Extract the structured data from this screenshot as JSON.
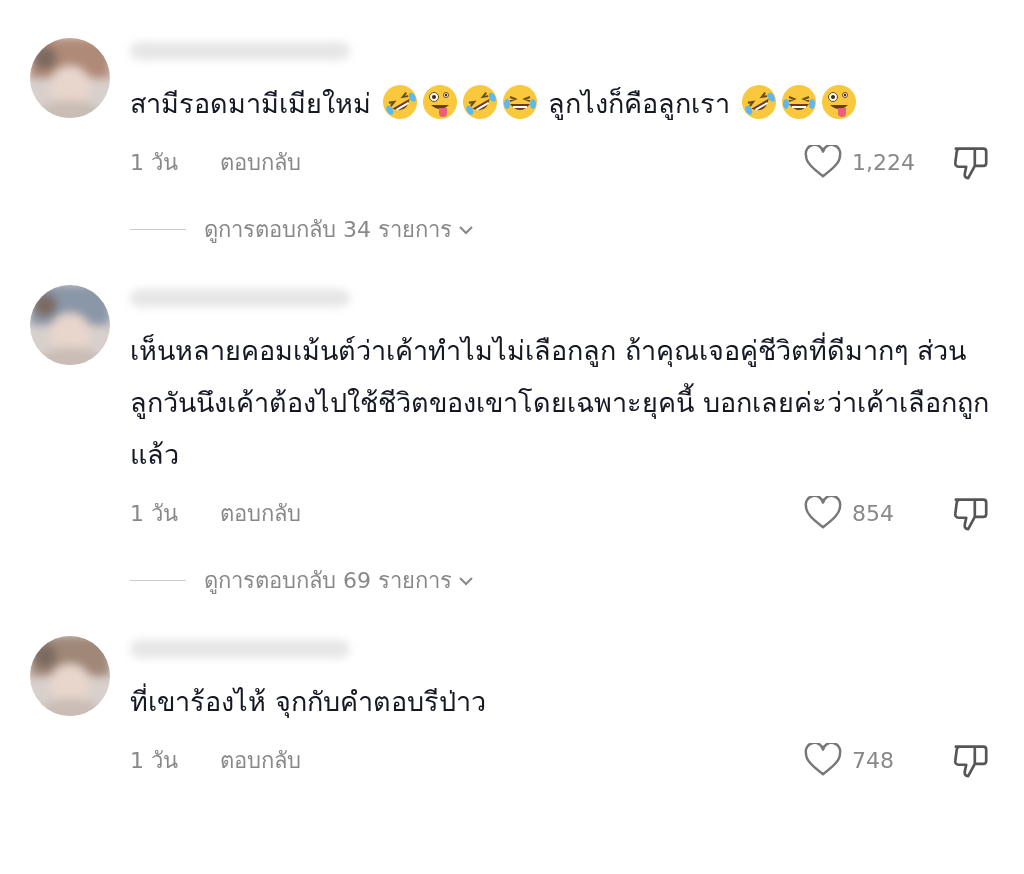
{
  "comments": [
    {
      "segments": [
        {
          "kind": "text",
          "text": "สามีรอดมามีเมียใหม่ "
        },
        {
          "kind": "rofl"
        },
        {
          "kind": "zany"
        },
        {
          "kind": "rofl"
        },
        {
          "kind": "joy"
        },
        {
          "kind": "text",
          "text": " ลูกไงก็คือลูกเรา "
        },
        {
          "kind": "rofl"
        },
        {
          "kind": "joy"
        },
        {
          "kind": "zany"
        }
      ],
      "time": "1 วัน",
      "reply": "ตอบกลับ",
      "likes": "1,224",
      "replies": "ดูการตอบกลับ 34 รายการ"
    },
    {
      "segments": [
        {
          "kind": "text",
          "text": "เห็นหลายคอมเม้นต์ว่าเค้าทำไมไม่เลือกลูก ถ้าคุณเจอคู่ชีวิตที่ดีมากๆ ส่วนลูกวันนึงเค้าต้องไปใช้ชีวิตของเขาโดยเฉพาะยุคนี้ บอกเลยค่ะว่าเค้าเลือกถูกแล้ว"
        }
      ],
      "time": "1 วัน",
      "reply": "ตอบกลับ",
      "likes": "854",
      "replies": "ดูการตอบกลับ 69 รายการ"
    },
    {
      "segments": [
        {
          "kind": "text",
          "text": "ที่เขาร้องไห้ จุกกับคำตอบรีป่าว"
        }
      ],
      "time": "1 วัน",
      "reply": "ตอบกลับ",
      "likes": "748"
    }
  ]
}
